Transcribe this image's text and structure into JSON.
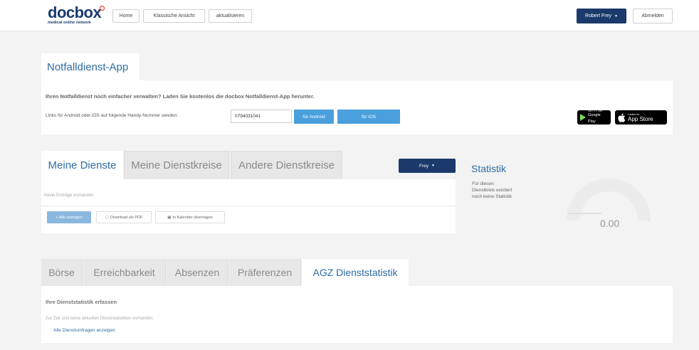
{
  "header": {
    "logo_text": "docbox",
    "logo_tagline": "medical online network",
    "nav": [
      "Home",
      "Klassische Ansicht",
      "aktualisieren"
    ],
    "user_label": "Robert Frey",
    "logout_label": "Abmelden"
  },
  "app_section": {
    "tab_label": "Notfalldienst-App",
    "headline": "Ihren Notfalldienst noch einfacher verwalten? Laden Sie kostenlos die docbox Notfalldienst-App herunter.",
    "phone_label": "Links für Android oder iOS auf folgende Handy-Nummer senden:",
    "phone_value": "0794031041",
    "android_button": "für Android",
    "ios_button": "für iOS",
    "google_play_small": "GET IT ON",
    "google_play_big": "Google Play",
    "app_store_small": "Laden im",
    "app_store_big": "App Store"
  },
  "dienste": {
    "tabs": [
      "Meine Dienste",
      "Meine Dienstkreise",
      "Andere Dienstkreise"
    ],
    "active_tab": 0,
    "filter_label": "Frey",
    "empty_text": "Keine Einträge vorhanden.",
    "show_all_button": "+ Alle anzeigen",
    "pdf_button": "Download als PDF",
    "calendar_button": "In Kalender übertragen"
  },
  "statistik": {
    "title": "Statistik",
    "description": "Für diesen Dienstkreis existiert noch keine Statistik",
    "gauge_value": "0.00",
    "gauge_fraction": 0
  },
  "bottom": {
    "tabs": [
      "Börse",
      "Erreichbarkeit",
      "Absenzen",
      "Präferenzen",
      "AGZ Dienststatistik"
    ],
    "active_tab": 4,
    "title": "Ihre Dienststatistik erfassen",
    "note": "Zur Zeit sind keine aktuellen Dienststatistiken vorhanden.",
    "link": "Alle Dienstumfragen anzeigen"
  },
  "colors": {
    "brand_navy": "#1b3a6b",
    "accent_blue": "#4a9fdd",
    "tab_blue": "#2e6da4",
    "page_bg": "#f3f3f3"
  },
  "icons": [
    "chevron-down-icon",
    "plus-icon",
    "pdf-icon",
    "calendar-icon",
    "google-play-icon",
    "apple-icon"
  ]
}
